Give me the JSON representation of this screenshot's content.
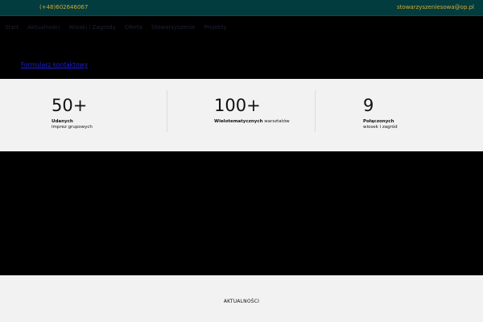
{
  "topbar": {
    "phone": "(+48)602646067",
    "email": "stowarzyszeniesowa@op.pl"
  },
  "nav": {
    "items": [
      {
        "label": "Start"
      },
      {
        "label": "Aktualności"
      },
      {
        "label": "Wioski i Zagrody"
      },
      {
        "label": "Oferta"
      },
      {
        "label": "Stowarzyszenie"
      },
      {
        "label": "Projekty"
      }
    ]
  },
  "contact_link": "Formularz kontaktowy",
  "stats": [
    {
      "number": "50+",
      "bold": "Udanych",
      "rest": "",
      "line2": "imprez grupowych"
    },
    {
      "number": "100+",
      "bold": "Wielotematycznych",
      "rest": " warsztatów",
      "line2": ""
    },
    {
      "number": "9",
      "bold": "Połączonych",
      "rest": "",
      "line2": "wiosek i zagród"
    }
  ],
  "bottom": {
    "heading": "AKTUALNOŚCI"
  },
  "colors": {
    "topbar_bg": "#023c3f",
    "topbar_text": "#d4a832",
    "link": "#1d1de0",
    "stats_bg": "#f2f2f2"
  }
}
